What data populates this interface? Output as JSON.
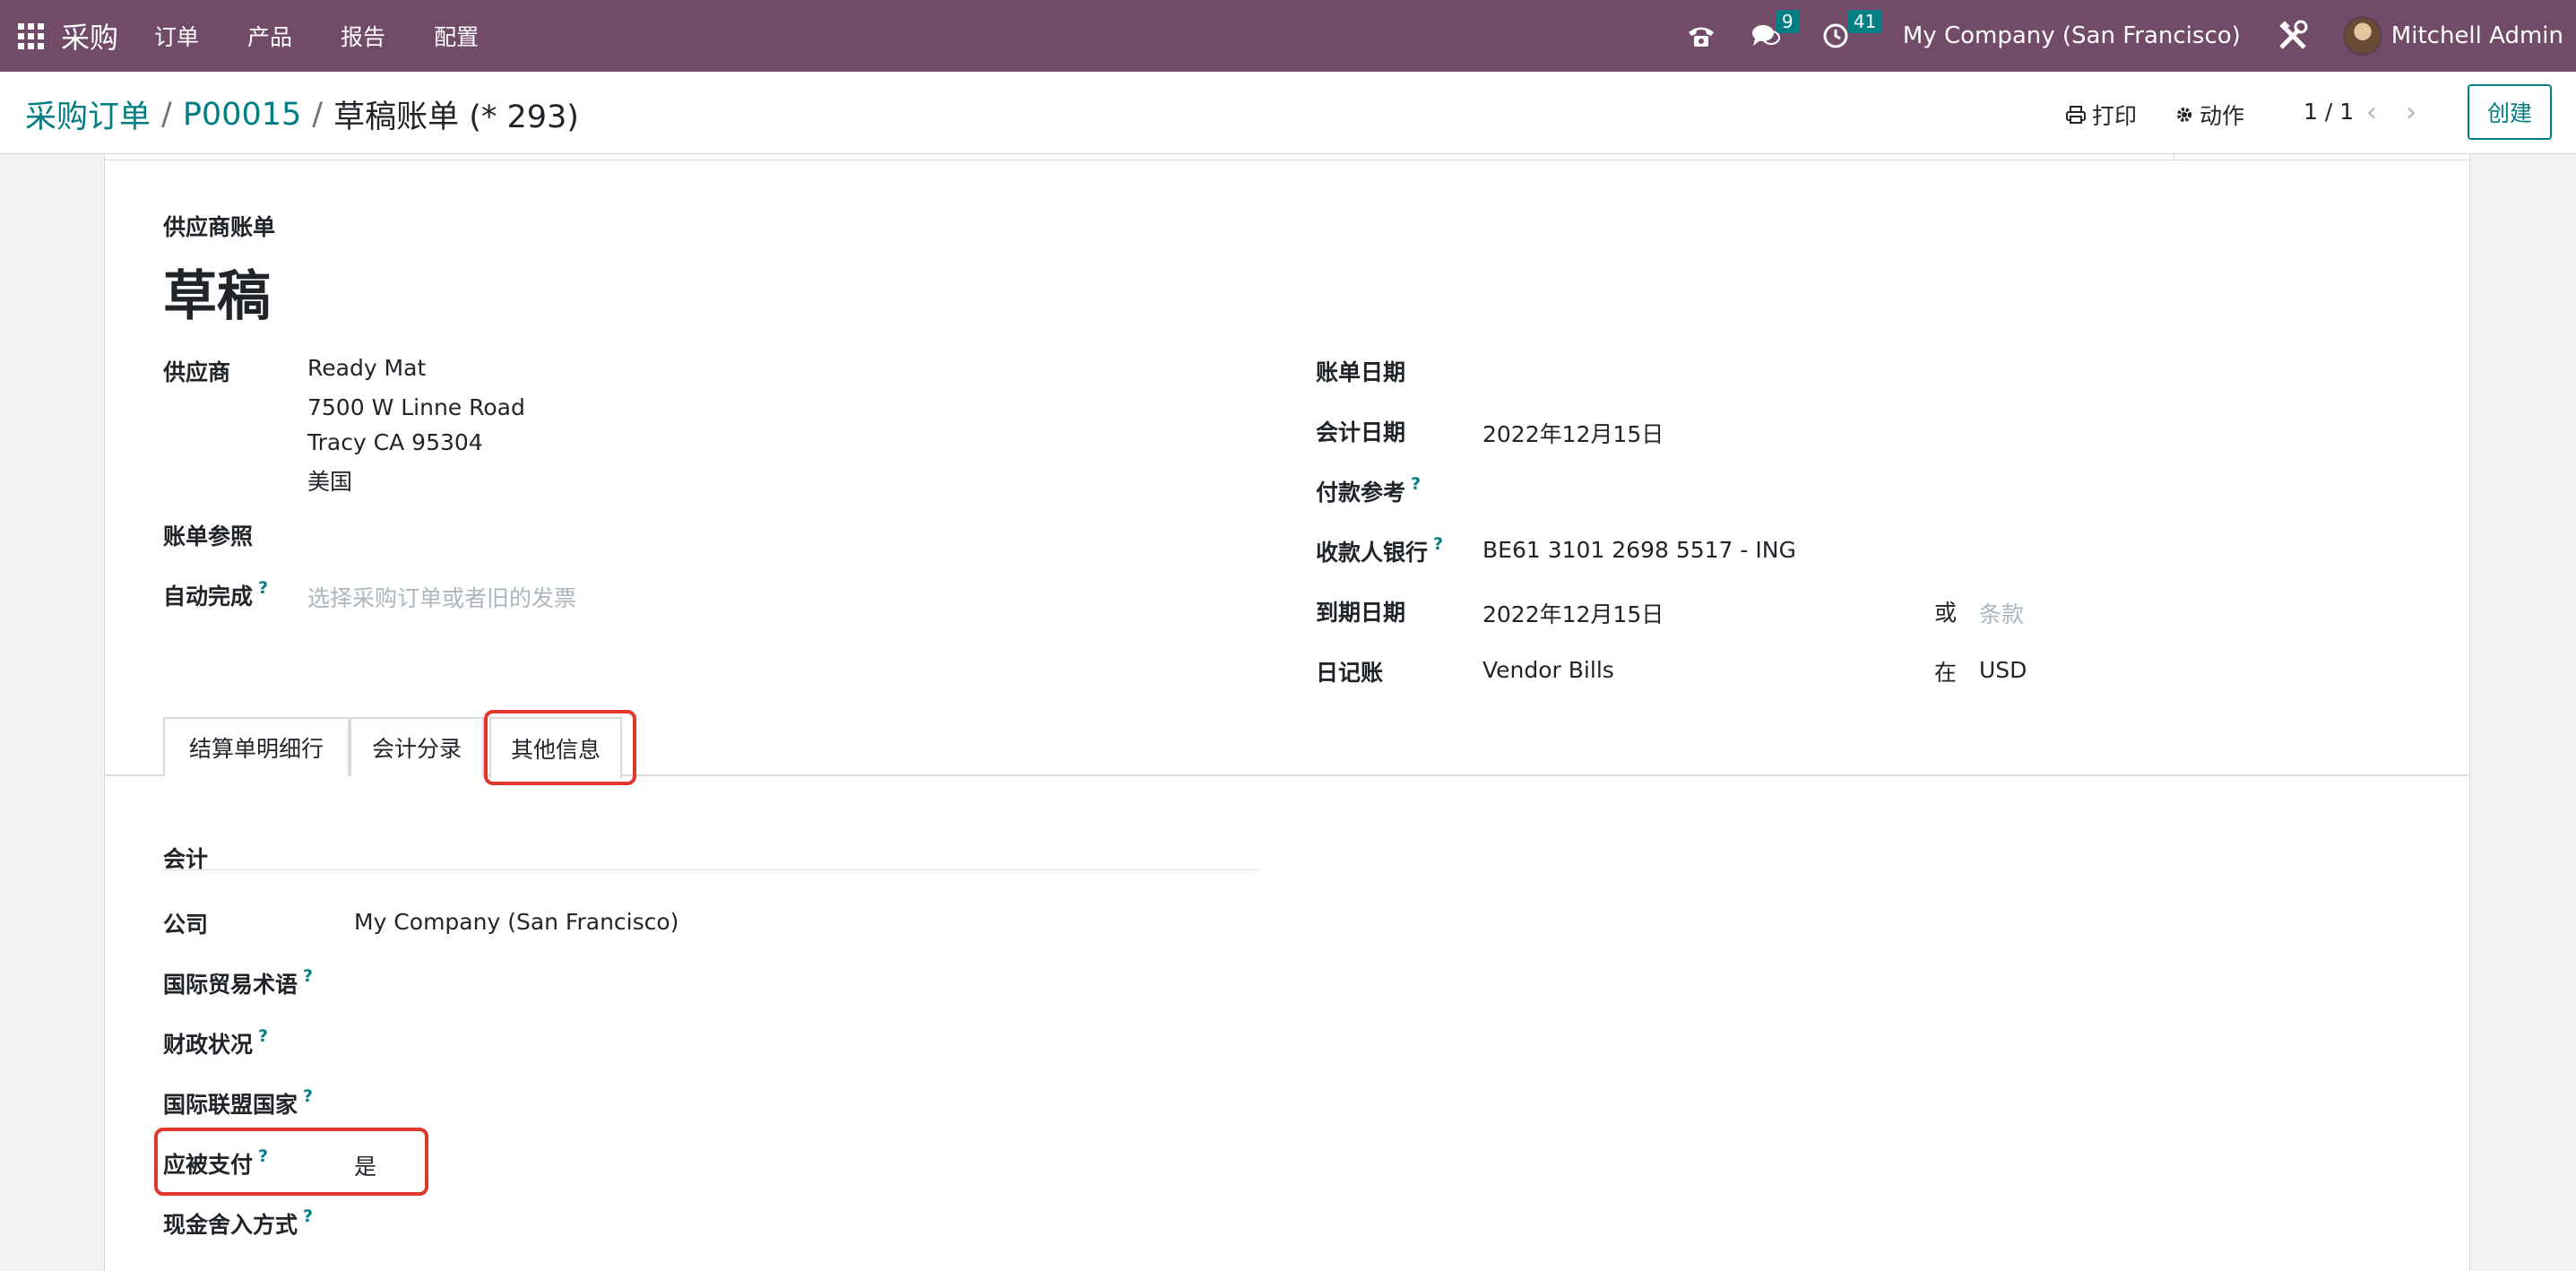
{
  "navbar": {
    "brand": "采购",
    "menu": [
      "订单",
      "产品",
      "报告",
      "配置"
    ],
    "messages_count": "9",
    "activities_count": "41",
    "company": "My Company (San Francisco)",
    "user": "Mitchell Admin"
  },
  "breadcrumb": {
    "items": [
      "采购订单",
      "P00015"
    ],
    "current": "草稿账单 (* 293)"
  },
  "controls": {
    "print": "打印",
    "action": "动作",
    "pager": "1 / 1",
    "create": "创建"
  },
  "form": {
    "subtitle": "供应商账单",
    "title": "草稿",
    "left": {
      "vendor_label": "供应商",
      "vendor_address": [
        "Ready Mat",
        "7500 W Linne Road",
        "Tracy CA 95304",
        "美国"
      ],
      "bill_ref_label": "账单参照",
      "autocomplete_label": "自动完成",
      "autocomplete_placeholder": "选择采购订单或者旧的发票"
    },
    "right": {
      "bill_date_label": "账单日期",
      "accounting_date_label": "会计日期",
      "accounting_date": "2022年12月15日",
      "payment_ref_label": "付款参考",
      "bank_label": "收款人银行",
      "bank": "BE61 3101 2698 5517 - ING",
      "due_date_label": "到期日期",
      "due_date": "2022年12月15日",
      "or_label": "或",
      "terms_placeholder": "条款",
      "journal_label": "日记账",
      "journal": "Vendor Bills",
      "in_label": "在",
      "currency": "USD"
    },
    "tabs": [
      "结算单明细行",
      "会计分录",
      "其他信息"
    ],
    "active_tab": "其他信息",
    "accounting": {
      "group_title": "会计",
      "company_label": "公司",
      "company": "My Company (San Francisco)",
      "incoterm_label": "国际贸易术语",
      "fiscal_position_label": "财政状况",
      "intrastat_label": "国际联盟国家",
      "to_check_label": "应被支付",
      "to_check_value": "是",
      "cash_rounding_label": "现金舍入方式"
    }
  },
  "colors": {
    "navbar": "#714b67",
    "accent": "#017e84",
    "highlight": "#e0362c"
  }
}
